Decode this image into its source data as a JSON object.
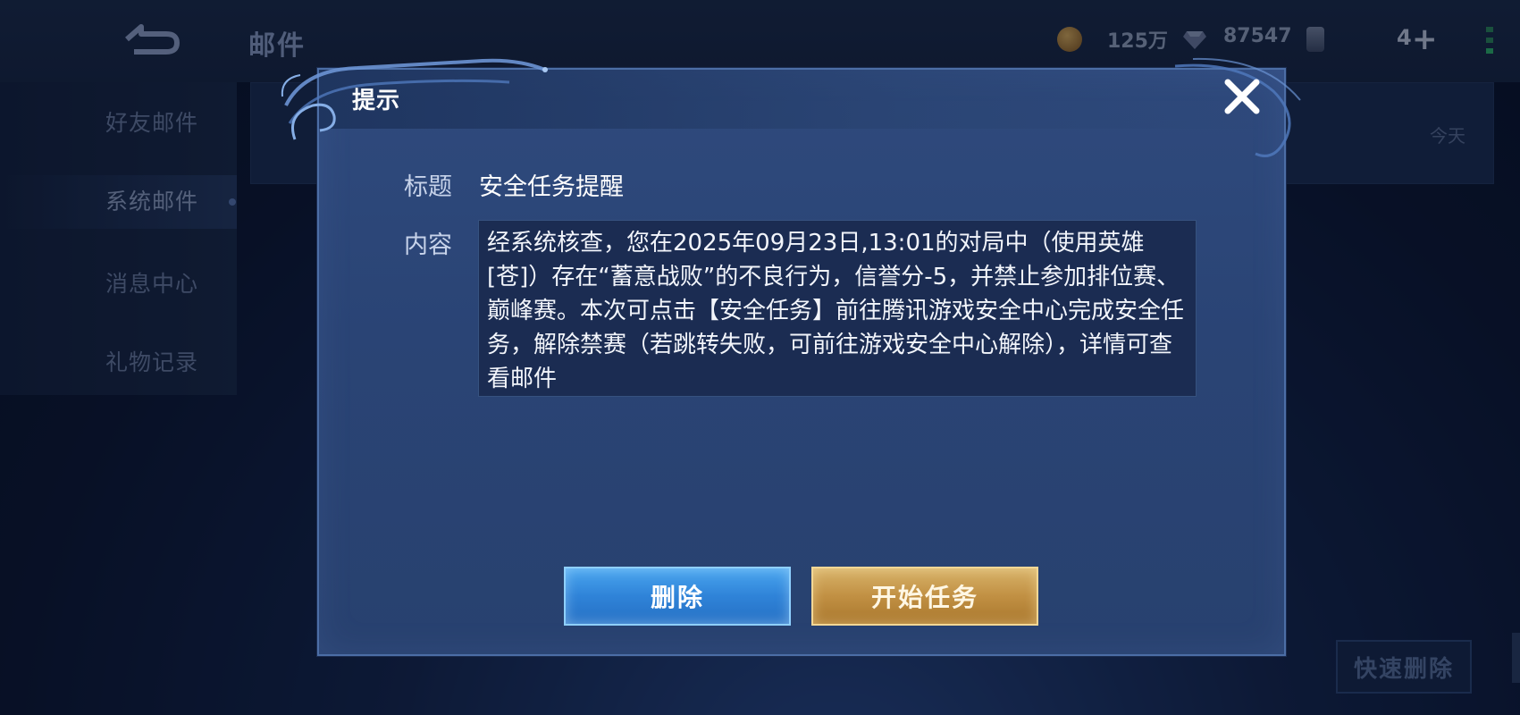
{
  "background": {
    "page_title": "邮件",
    "coins": "125万",
    "gems": "87547",
    "level": "4",
    "sidebar": {
      "items": [
        {
          "label": "好友邮件"
        },
        {
          "label": "系统邮件"
        },
        {
          "label": "消息中心"
        },
        {
          "label": "礼物记录"
        }
      ],
      "active": "系统邮件"
    },
    "mail_date": "今天",
    "quick_delete_label": "快速删除"
  },
  "dialog": {
    "title": "提示",
    "subject_label": "标题",
    "subject_value": "安全任务提醒",
    "content_label": "内容",
    "content_text": "经系统核查，您在2025年09月23日,13:01的对局中（使用英雄[苍]）存在“蓄意战败”的不良行为，信誉分-5，并禁止参加排位赛、巅峰赛。本次可点击【安全任务】前往腾讯游戏安全中心完成安全任务，解除禁赛（若跳转失败，可前往游戏安全中心解除），详情可查看邮件",
    "delete_label": "删除",
    "start_label": "开始任务"
  },
  "colors": {
    "dialog_bg": "#2d477a",
    "delete_button": "#2f83d8",
    "start_button": "#c19043"
  },
  "icons": [
    "back-icon",
    "coin-icon",
    "gem-icon",
    "card-icon",
    "plus-icon",
    "signal-icon",
    "close-icon"
  ]
}
